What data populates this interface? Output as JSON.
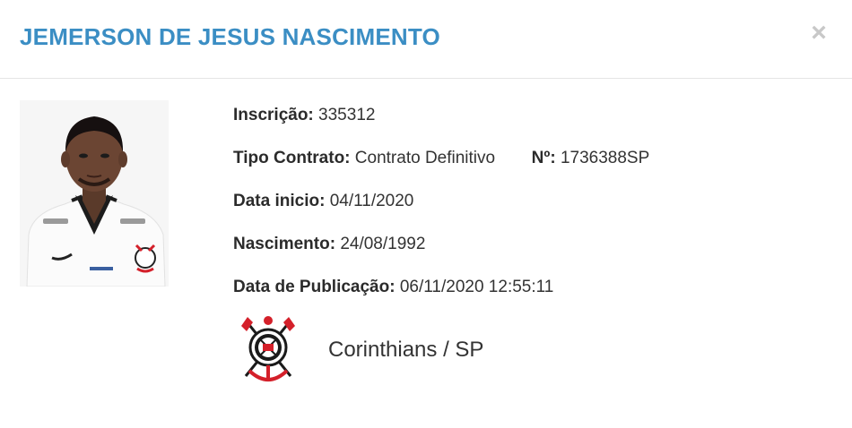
{
  "header": {
    "title": "JEMERSON DE JESUS NASCIMENTO",
    "close_label": "×"
  },
  "player": {
    "inscricao_label": "Inscrição:",
    "inscricao_value": "335312",
    "tipo_contrato_label": "Tipo Contrato:",
    "tipo_contrato_value": "Contrato Definitivo",
    "numero_label": "Nº:",
    "numero_value": "1736388SP",
    "data_inicio_label": "Data inicio:",
    "data_inicio_value": "04/11/2020",
    "nascimento_label": "Nascimento:",
    "nascimento_value": "24/08/1992",
    "publicacao_label": "Data de Publicação:",
    "publicacao_value": "06/11/2020 12:55:11"
  },
  "club": {
    "name": "Corinthians / SP"
  },
  "colors": {
    "title": "#3b8ec4",
    "crest_red": "#d4202a",
    "crest_black": "#1a1a1a"
  },
  "icons": {
    "close": "close-icon",
    "crest": "corinthians-crest-icon",
    "photo": "player-photo"
  }
}
